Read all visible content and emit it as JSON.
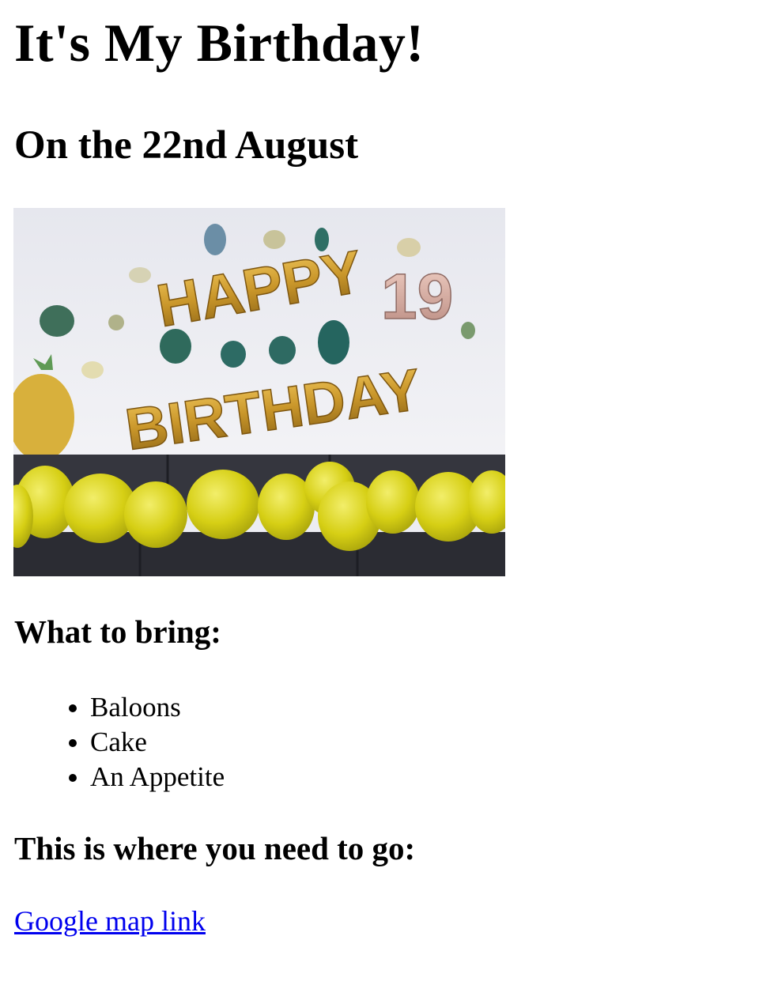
{
  "page": {
    "title": "It's My Birthday!",
    "subtitle": "On the 22nd August",
    "image": {
      "description_icon": "birthday-photo",
      "balloon_words": [
        "HAPPY",
        "19",
        "BIRTHDAY"
      ]
    },
    "bring": {
      "heading": "What to bring:",
      "items": [
        "Baloons",
        "Cake",
        "An Appetite"
      ]
    },
    "where": {
      "heading": "This is where you need to go:",
      "link_label": "Google map link"
    }
  },
  "colors": {
    "link": "#0000ee",
    "gold": "#c9962a",
    "yellow_balloon": "#d8d316",
    "sofa": "#2f3038",
    "wall": "#ecedf2"
  }
}
